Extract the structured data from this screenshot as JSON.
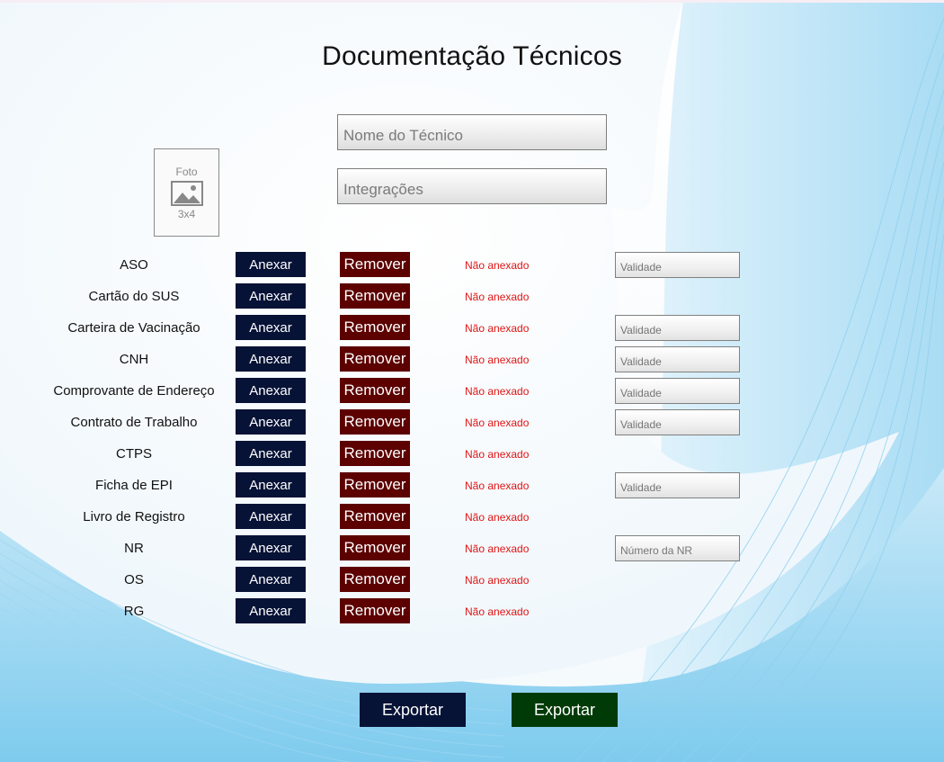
{
  "title": "Documentação Técnicos",
  "photo": {
    "line1": "Foto",
    "line2": "3x4",
    "icon": "image-icon"
  },
  "fields": {
    "name_placeholder": "Nome do Técnico",
    "integrations_placeholder": "Integrações"
  },
  "buttons": {
    "attach": "Anexar",
    "remove": "Remover"
  },
  "status_text": "Não anexado",
  "validity_placeholder": "Validade",
  "nr_placeholder": "Número da NR",
  "documents": [
    {
      "label": "ASO",
      "field": "Validade"
    },
    {
      "label": "Cartão do SUS",
      "field": null
    },
    {
      "label": "Carteira de Vacinação",
      "field": "Validade"
    },
    {
      "label": "CNH",
      "field": "Validade"
    },
    {
      "label": "Comprovante de Endereço",
      "field": "Validade"
    },
    {
      "label": "Contrato de Trabalho",
      "field": "Validade"
    },
    {
      "label": "CTPS",
      "field": null
    },
    {
      "label": "Ficha de EPI",
      "field": "Validade"
    },
    {
      "label": "Livro de Registro",
      "field": null
    },
    {
      "label": "NR",
      "field": "Número da NR"
    },
    {
      "label": "OS",
      "field": null
    },
    {
      "label": "RG",
      "field": null
    }
  ],
  "export_buttons": [
    "Exportar",
    "Exportar"
  ],
  "colors": {
    "attach_button": "#061236",
    "remove_button": "#5c0000",
    "status_text": "#e01515",
    "export_primary": "#061236",
    "export_secondary": "#003a06",
    "wave_accent": "#7ecbee"
  }
}
